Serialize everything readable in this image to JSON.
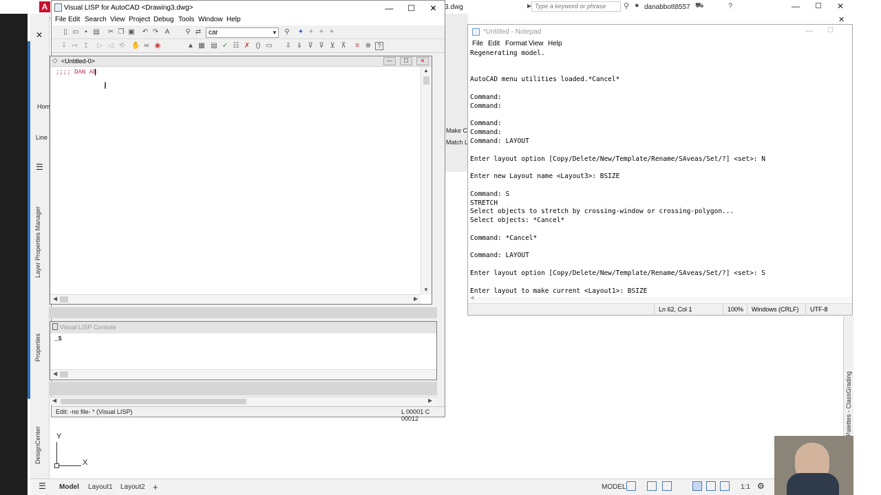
{
  "autocad": {
    "top_file_fragment": "3.dwg",
    "search_placeholder": "Type a keyword or phrase",
    "user": "danabbott8557",
    "left_labels": [
      "Hom",
      "Line"
    ],
    "right_fragments": [
      "Make Cu",
      "Match L"
    ],
    "side_palettes": [
      "Layer Properties Manager",
      "Properties",
      "DesignCenter"
    ],
    "right_palette": "ol Palettes - ClassGrading",
    "ucs": {
      "y": "Y",
      "x": "X"
    },
    "bottom_tabs": [
      "Model",
      "Layout1",
      "Layout2"
    ],
    "add_tab": "+",
    "status_model": "MODEL",
    "scale": "1:1"
  },
  "vlisp": {
    "title": "Visual LISP for AutoCAD <Drawing3.dwg>",
    "menu": [
      "File",
      "Edit",
      "Search",
      "View",
      "Project",
      "Debug",
      "Tools",
      "Window",
      "Help"
    ],
    "search_value": "car",
    "editor": {
      "title": "<Untitled-0>",
      "code": ";;;; DAN AB"
    },
    "console": {
      "title": "Visual LISP Console",
      "prompt": "_$"
    },
    "status": {
      "left": "Edit: -no file- * (Visual LISP)",
      "right": "L 00001  C 00012"
    }
  },
  "notepad": {
    "title": "*Untitled - Notepad",
    "menu": [
      "File",
      "Edit",
      "Format",
      "View",
      "Help"
    ],
    "lines": [
      "Regenerating model.",
      "",
      "",
      "AutoCAD menu utilities loaded.*Cancel*",
      "",
      "Command:",
      "Command:",
      "",
      "Command:",
      "Command:",
      "Command: LAYOUT",
      "",
      "Enter layout option [Copy/Delete/New/Template/Rename/SAveas/Set/?] <set>: N",
      "",
      "Enter new Layout name <Layout3>: BSIZE",
      "",
      "Command: S",
      "STRETCH",
      "Select objects to stretch by crossing-window or crossing-polygon...",
      "Select objects: *Cancel*",
      "",
      "Command: *Cancel*",
      "",
      "Command: LAYOUT",
      "",
      "Enter layout option [Copy/Delete/New/Template/Rename/SAveas/Set/?] <set>: S",
      "",
      "Enter layout to make current <Layout1>: BSIZE"
    ],
    "status": {
      "position": "Ln 62, Col 1",
      "zoom": "100%",
      "eol": "Windows (CRLF)",
      "encoding": "UTF-8"
    }
  },
  "window_controls": {
    "minimize": "—",
    "maximize": "☐",
    "close": "✕"
  }
}
